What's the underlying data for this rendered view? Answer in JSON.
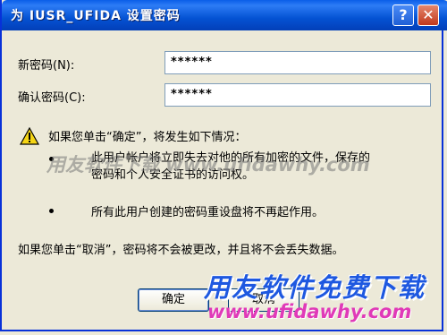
{
  "window": {
    "title": "为 IUSR_UFIDA 设置密码",
    "help_glyph": "?",
    "close_glyph": "✕"
  },
  "form": {
    "new_password_label": "新密码(N):",
    "new_password_value": "******",
    "confirm_password_label": "确认密码(C):",
    "confirm_password_value": "******"
  },
  "warning": {
    "icon": "warning-triangle-icon",
    "intro": "如果您单击“确定”，将发生如下情况：",
    "bullet1_line1": "此用户帐户将立即失去对他的所有加密的文件，保存的",
    "bullet1_line2": "密码和个人安全证书的访问权。",
    "bullet2": "所有此用户创建的密码重设盘将不再起作用。"
  },
  "cancel_note": "如果您单击“取消”，密码将不会被更改，并且将不会丢失数据。",
  "buttons": {
    "ok": "确定",
    "cancel": "取消"
  },
  "watermark": {
    "overlay_text": "用友软件下载 www.ufidawhy.com",
    "logo_text": "用友软件免费下载",
    "logo_url": "www.ufidawhy.com"
  },
  "colors": {
    "titlebar": "#0452d3",
    "logo_blue": "#1e58e0",
    "logo_pink": "#e03ab8"
  }
}
